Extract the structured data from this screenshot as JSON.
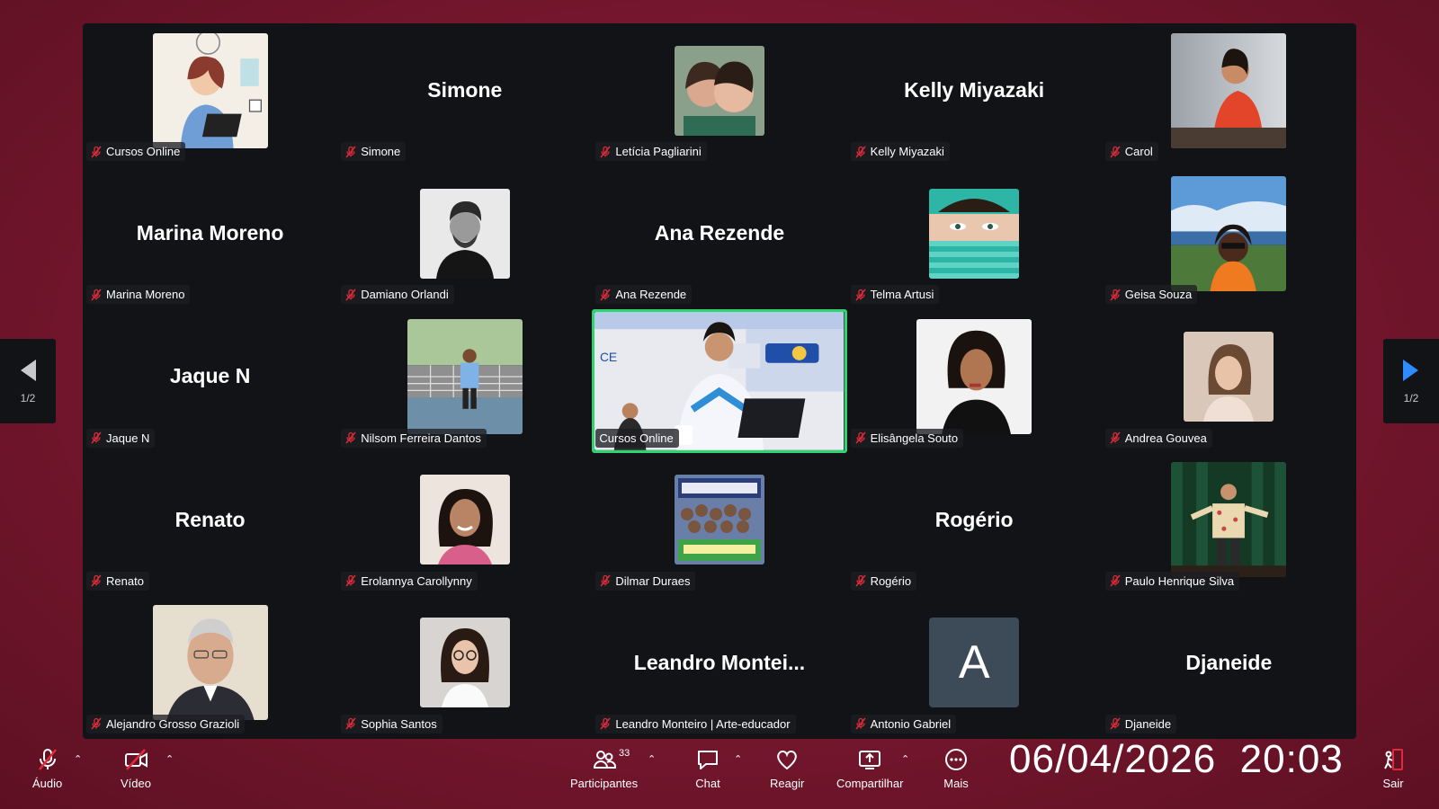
{
  "meeting": {
    "participants": [
      {
        "id": "p01",
        "display": "photo",
        "photo": "illustration",
        "label": "Cursos Online",
        "muted": true
      },
      {
        "id": "p02",
        "display": "name",
        "big_name": "Simone",
        "label": "Simone",
        "muted": true
      },
      {
        "id": "p03",
        "display": "photo",
        "photo": "two-women",
        "label": "Letícia Pagliarini",
        "muted": true
      },
      {
        "id": "p04",
        "display": "name",
        "big_name": "Kelly Miyazaki",
        "label": "Kelly Miyazaki",
        "muted": true
      },
      {
        "id": "p05",
        "display": "photo",
        "photo": "woman-orange",
        "label": "Carol",
        "muted": true
      },
      {
        "id": "p06",
        "display": "name",
        "big_name": "Marina Moreno",
        "label": "Marina Moreno",
        "muted": true
      },
      {
        "id": "p07",
        "display": "photo",
        "photo": "man-bw",
        "label": "Damiano Orlandi",
        "muted": true
      },
      {
        "id": "p08",
        "display": "name",
        "big_name": "Ana Rezende",
        "label": "Ana Rezende",
        "muted": true
      },
      {
        "id": "p09",
        "display": "photo",
        "photo": "eyes-teal",
        "label": "Telma Artusi",
        "muted": true
      },
      {
        "id": "p10",
        "display": "photo",
        "photo": "woman-lake",
        "label": "Geisa Souza",
        "muted": true
      },
      {
        "id": "p11",
        "display": "name",
        "big_name": "Jaque N",
        "label": "Jaque N",
        "muted": true
      },
      {
        "id": "p12",
        "display": "photo",
        "photo": "tennis",
        "label": "Nilsom Ferreira Dantos",
        "muted": true
      },
      {
        "id": "p13",
        "display": "video",
        "photo": "speaker-video",
        "label": "Cursos Online",
        "muted": false,
        "active": true
      },
      {
        "id": "p14",
        "display": "photo",
        "photo": "woman-dark",
        "label": "Elisângela Souto",
        "muted": true
      },
      {
        "id": "p15",
        "display": "photo",
        "photo": "woman-light",
        "label": "Andrea Gouvea",
        "muted": true
      },
      {
        "id": "p16",
        "display": "name",
        "big_name": "Renato",
        "label": "Renato",
        "muted": true
      },
      {
        "id": "p17",
        "display": "photo",
        "photo": "woman-smile",
        "label": "Erolannya Carollynny",
        "muted": true
      },
      {
        "id": "p18",
        "display": "photo",
        "photo": "group",
        "label": "Dilmar Duraes",
        "muted": true
      },
      {
        "id": "p19",
        "display": "name",
        "big_name": "Rogério",
        "label": "Rogério",
        "muted": true
      },
      {
        "id": "p20",
        "display": "photo",
        "photo": "stage-man",
        "label": "Paulo Henrique Silva",
        "muted": true
      },
      {
        "id": "p21",
        "display": "photo",
        "photo": "old-man",
        "label": "Alejandro Grosso Grazioli",
        "muted": true
      },
      {
        "id": "p22",
        "display": "photo",
        "photo": "woman-glasses",
        "label": "Sophia Santos",
        "muted": true
      },
      {
        "id": "p23",
        "display": "name",
        "big_name": "Leandro  Montei...",
        "label": "Leandro Monteiro | Arte-educador",
        "muted": true
      },
      {
        "id": "p24",
        "display": "letter",
        "letter": "A",
        "label": "Antonio Gabriel",
        "muted": true
      },
      {
        "id": "p25",
        "display": "name",
        "big_name": "Djaneide",
        "label": "Djaneide",
        "muted": true
      }
    ]
  },
  "pagination": {
    "left_page": "1/2",
    "right_page": "1/2"
  },
  "toolbar": {
    "audio_label": "Áudio",
    "video_label": "Vídeo",
    "participants_label": "Participantes",
    "participants_count": "33",
    "chat_label": "Chat",
    "react_label": "Reagir",
    "share_label": "Compartilhar",
    "more_label": "Mais",
    "leave_label": "Sair"
  },
  "clock": {
    "date": "06/04/2026",
    "time": "20:03"
  },
  "colors": {
    "background": "#7a1830",
    "stage": "#111316",
    "active_border": "#2fd36f",
    "muted_icon": "#e02b3a",
    "nav_arrow_right": "#2d8cff"
  }
}
